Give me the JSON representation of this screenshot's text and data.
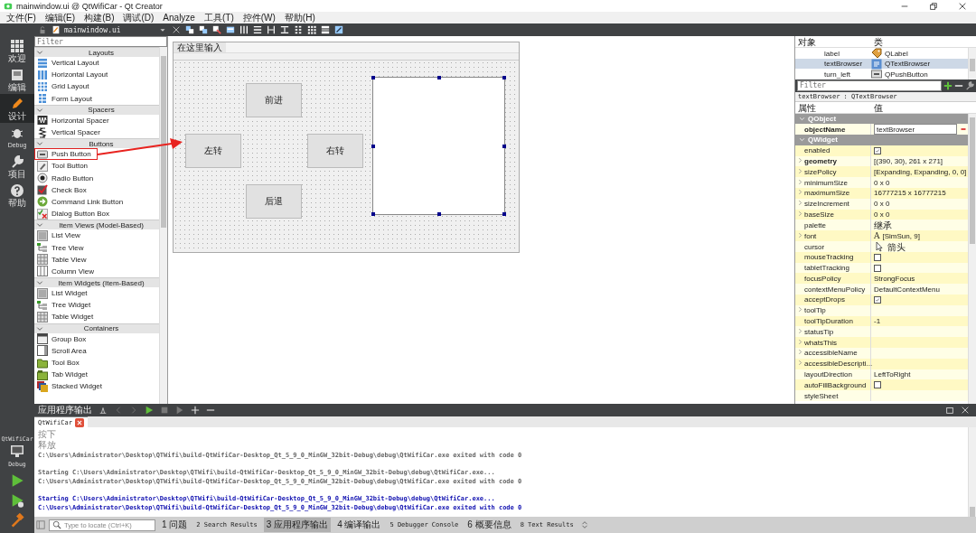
{
  "window": {
    "title": "mainwindow.ui @ QtWifiCar - Qt Creator"
  },
  "menu": [
    "文件(F)",
    "编辑(E)",
    "构建(B)",
    "调试(D)",
    "Analyze",
    "工具(T)",
    "控件(W)",
    "帮助(H)"
  ],
  "editor_toolbar": {
    "file": "mainwindow.ui"
  },
  "modes": [
    {
      "label": "欢迎",
      "selected": false
    },
    {
      "label": "编辑",
      "selected": false
    },
    {
      "label": "设计",
      "selected": true
    },
    {
      "label": "Debug",
      "selected": false
    },
    {
      "label": "项目",
      "selected": false
    },
    {
      "label": "帮助",
      "selected": false
    }
  ],
  "kit": {
    "project": "QtWifiCar",
    "build": "Debug"
  },
  "widget_box": {
    "filter_placeholder": "Filter",
    "categories": [
      {
        "title": "Layouts",
        "expanded": true,
        "items": [
          {
            "label": "Vertical Layout",
            "highlighted": false
          },
          {
            "label": "Horizontal Layout",
            "highlighted": false
          },
          {
            "label": "Grid Layout",
            "highlighted": false
          },
          {
            "label": "Form Layout",
            "highlighted": false
          }
        ]
      },
      {
        "title": "Spacers",
        "expanded": true,
        "items": [
          {
            "label": "Horizontal Spacer",
            "highlighted": false
          },
          {
            "label": "Vertical Spacer",
            "highlighted": false
          }
        ]
      },
      {
        "title": "Buttons",
        "expanded": true,
        "items": [
          {
            "label": "Push Button",
            "highlighted": true
          },
          {
            "label": "Tool Button",
            "highlighted": false
          },
          {
            "label": "Radio Button",
            "highlighted": false
          },
          {
            "label": "Check Box",
            "highlighted": false
          },
          {
            "label": "Command Link Button",
            "highlighted": false
          },
          {
            "label": "Dialog Button Box",
            "highlighted": false
          }
        ]
      },
      {
        "title": "Item Views (Model-Based)",
        "expanded": true,
        "items": [
          {
            "label": "List View",
            "highlighted": false
          },
          {
            "label": "Tree View",
            "highlighted": false
          },
          {
            "label": "Table View",
            "highlighted": false
          },
          {
            "label": "Column View",
            "highlighted": false
          }
        ]
      },
      {
        "title": "Item Widgets (Item-Based)",
        "expanded": true,
        "items": [
          {
            "label": "List Widget",
            "highlighted": false
          },
          {
            "label": "Tree Widget",
            "highlighted": false
          },
          {
            "label": "Table Widget",
            "highlighted": false
          }
        ]
      },
      {
        "title": "Containers",
        "expanded": true,
        "items": [
          {
            "label": "Group Box",
            "highlighted": false
          },
          {
            "label": "Scroll Area",
            "highlighted": false
          },
          {
            "label": "Tool Box",
            "highlighted": false
          },
          {
            "label": "Tab Widget",
            "highlighted": false
          },
          {
            "label": "Stacked Widget",
            "highlighted": false
          }
        ]
      }
    ]
  },
  "form": {
    "menu_placeholder": "在这里输入",
    "buttons": [
      "前进",
      "左转",
      "右转",
      "后退"
    ],
    "text_browser": {
      "selected": true
    }
  },
  "object_inspector": {
    "columns": [
      "对象",
      "类"
    ],
    "rows": [
      {
        "name": "label",
        "class": "QLabel",
        "kind": "label",
        "selected": false
      },
      {
        "name": "textBrowser",
        "class": "QTextBrowser",
        "kind": "textbrowser",
        "selected": true
      },
      {
        "name": "turn_left",
        "class": "QPushButton",
        "kind": "pushbutton",
        "selected": false
      }
    ]
  },
  "property_editor": {
    "filter_placeholder": "Filter",
    "object": "textBrowser : QTextBrowser",
    "columns": [
      "属性",
      "值"
    ],
    "groups": [
      {
        "title": "QObject",
        "expanded": true,
        "properties": [
          {
            "name": "objectName",
            "kind": "edit",
            "value": "textBrowser",
            "modified": true,
            "expandable": false
          }
        ]
      },
      {
        "title": "QWidget",
        "expanded": true,
        "properties": [
          {
            "name": "enabled",
            "kind": "check",
            "checked": true,
            "modified": false,
            "expandable": false
          },
          {
            "name": "geometry",
            "kind": "text",
            "value": "[(390, 30), 261 x 271]",
            "modified": true,
            "expandable": true
          },
          {
            "name": "sizePolicy",
            "kind": "text",
            "value": "[Expanding, Expanding, 0, 0]",
            "modified": false,
            "expandable": true
          },
          {
            "name": "minimumSize",
            "kind": "text",
            "value": "0 x 0",
            "modified": false,
            "expandable": true
          },
          {
            "name": "maximumSize",
            "kind": "text",
            "value": "16777215 x 16777215",
            "modified": false,
            "expandable": true
          },
          {
            "name": "sizeIncrement",
            "kind": "text",
            "value": "0 x 0",
            "modified": false,
            "expandable": true
          },
          {
            "name": "baseSize",
            "kind": "text",
            "value": "0 x 0",
            "modified": false,
            "expandable": true
          },
          {
            "name": "palette",
            "kind": "text",
            "value": "继承",
            "modified": false,
            "expandable": false
          },
          {
            "name": "font",
            "kind": "font",
            "glyph": "A",
            "value": "[SimSun, 9]",
            "modified": false,
            "expandable": true
          },
          {
            "name": "cursor",
            "kind": "cursor",
            "value": "箭头",
            "modified": false,
            "expandable": false
          },
          {
            "name": "mouseTracking",
            "kind": "check",
            "checked": false,
            "modified": false,
            "expandable": false
          },
          {
            "name": "tabletTracking",
            "kind": "check",
            "checked": false,
            "modified": false,
            "expandable": false
          },
          {
            "name": "focusPolicy",
            "kind": "text",
            "value": "StrongFocus",
            "modified": false,
            "expandable": false
          },
          {
            "name": "contextMenuPolicy",
            "kind": "text",
            "value": "DefaultContextMenu",
            "modified": false,
            "expandable": false
          },
          {
            "name": "acceptDrops",
            "kind": "check",
            "checked": true,
            "modified": false,
            "expandable": false
          },
          {
            "name": "toolTip",
            "kind": "text",
            "modified": false,
            "expandable": true
          },
          {
            "name": "toolTipDuration",
            "kind": "text",
            "value": "-1",
            "modified": false,
            "expandable": false
          },
          {
            "name": "statusTip",
            "kind": "text",
            "modified": false,
            "expandable": true
          },
          {
            "name": "whatsThis",
            "kind": "text",
            "modified": false,
            "expandable": true
          },
          {
            "name": "accessibleName",
            "kind": "text",
            "modified": false,
            "expandable": true
          },
          {
            "name": "accessibleDescripti...",
            "kind": "text",
            "modified": false,
            "expandable": true
          },
          {
            "name": "layoutDirection",
            "kind": "text",
            "value": "LeftToRight",
            "modified": false,
            "expandable": false
          },
          {
            "name": "autoFillBackground",
            "kind": "check",
            "checked": false,
            "modified": false,
            "expandable": false
          },
          {
            "name": "styleSheet",
            "kind": "text",
            "modified": false,
            "expandable": false
          }
        ]
      }
    ]
  },
  "output_pane": {
    "title": "应用程序输出",
    "tabs": [
      {
        "label": "QtWifiCar",
        "selected": true
      }
    ],
    "lines": [
      {
        "text": "按下",
        "kind": "app",
        "gap_before": false
      },
      {
        "text": "释放",
        "kind": "app",
        "gap_before": false
      },
      {
        "text": "C:\\Users\\Administrator\\Desktop\\QTWifi\\build-QtWifiCar-Desktop_Qt_5_9_0_MinGW_32bit-Debug\\debug\\QtWifiCar.exe exited with code 0",
        "kind": "system",
        "gap_before": false
      },
      {
        "text": "Starting C:\\Users\\Administrator\\Desktop\\QTWifi\\build-QtWifiCar-Desktop_Qt_5_9_0_MinGW_32bit-Debug\\debug\\QtWifiCar.exe...",
        "kind": "system",
        "gap_before": true
      },
      {
        "text": "C:\\Users\\Administrator\\Desktop\\QTWifi\\build-QtWifiCar-Desktop_Qt_5_9_0_MinGW_32bit-Debug\\debug\\QtWifiCar.exe exited with code 0",
        "kind": "system",
        "gap_before": false
      },
      {
        "text": "Starting C:\\Users\\Administrator\\Desktop\\QTWifi\\build-QtWifiCar-Desktop_Qt_5_9_0_MinGW_32bit-Debug\\debug\\QtWifiCar.exe...",
        "kind": "current",
        "gap_before": true
      },
      {
        "text": "C:\\Users\\Administrator\\Desktop\\QTWifi\\build-QtWifiCar-Desktop_Qt_5_9_0_MinGW_32bit-Debug\\debug\\QtWifiCar.exe exited with code 0",
        "kind": "current",
        "gap_before": false
      }
    ]
  },
  "status_bar": {
    "locate_placeholder": "Type to locate (Ctrl+K)",
    "panes": [
      {
        "label": "1 问题",
        "selected": false
      },
      {
        "label": "2 Search Results",
        "selected": false
      },
      {
        "label": "3 应用程序输出",
        "selected": true
      },
      {
        "label": "4 编译输出",
        "selected": false
      },
      {
        "label": "5 Debugger Console",
        "selected": false
      },
      {
        "label": "6 概要信息",
        "selected": false
      },
      {
        "label": "8 Text Results",
        "selected": false
      }
    ]
  }
}
